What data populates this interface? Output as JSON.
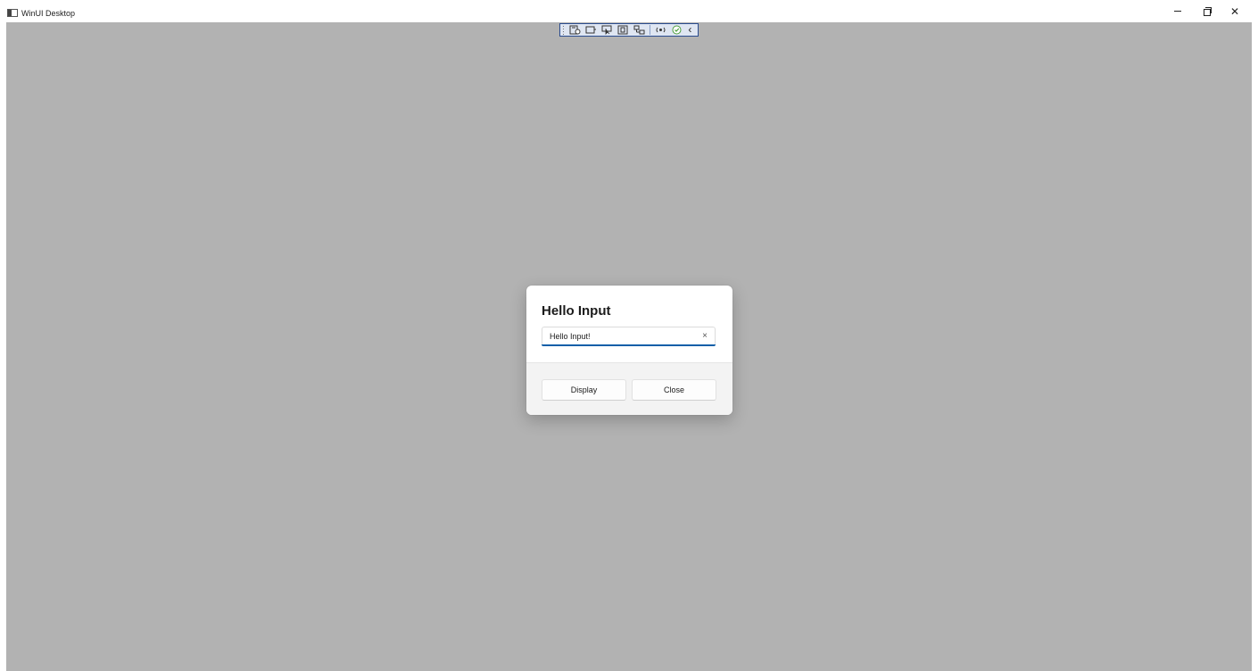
{
  "window": {
    "title": "WinUI Desktop",
    "icon": "app-window-icon",
    "caption_icons": [
      "minimize-icon",
      "restore-icon",
      "close-icon"
    ],
    "close_glyph": "✕"
  },
  "debug_toolbar": {
    "icons": [
      "live-visual-tree-icon",
      "select-element-icon",
      "display-layout-adorners-icon",
      "track-focused-element-icon",
      "binding-failures-icon",
      "hot-reload-status-icon",
      "collapse-chevron-icon"
    ],
    "collapse_glyph": "‹"
  },
  "dialog": {
    "title": "Hello Input",
    "textbox": {
      "value": "Hello Input!",
      "clear_glyph": "×"
    },
    "primary_button_label": "Display",
    "close_button_label": "Close"
  },
  "colors": {
    "overlay": "#b2b2b2",
    "accent": "#0f5fa8",
    "dialog_background": "#ffffff",
    "footer_background": "#f3f3f3"
  }
}
